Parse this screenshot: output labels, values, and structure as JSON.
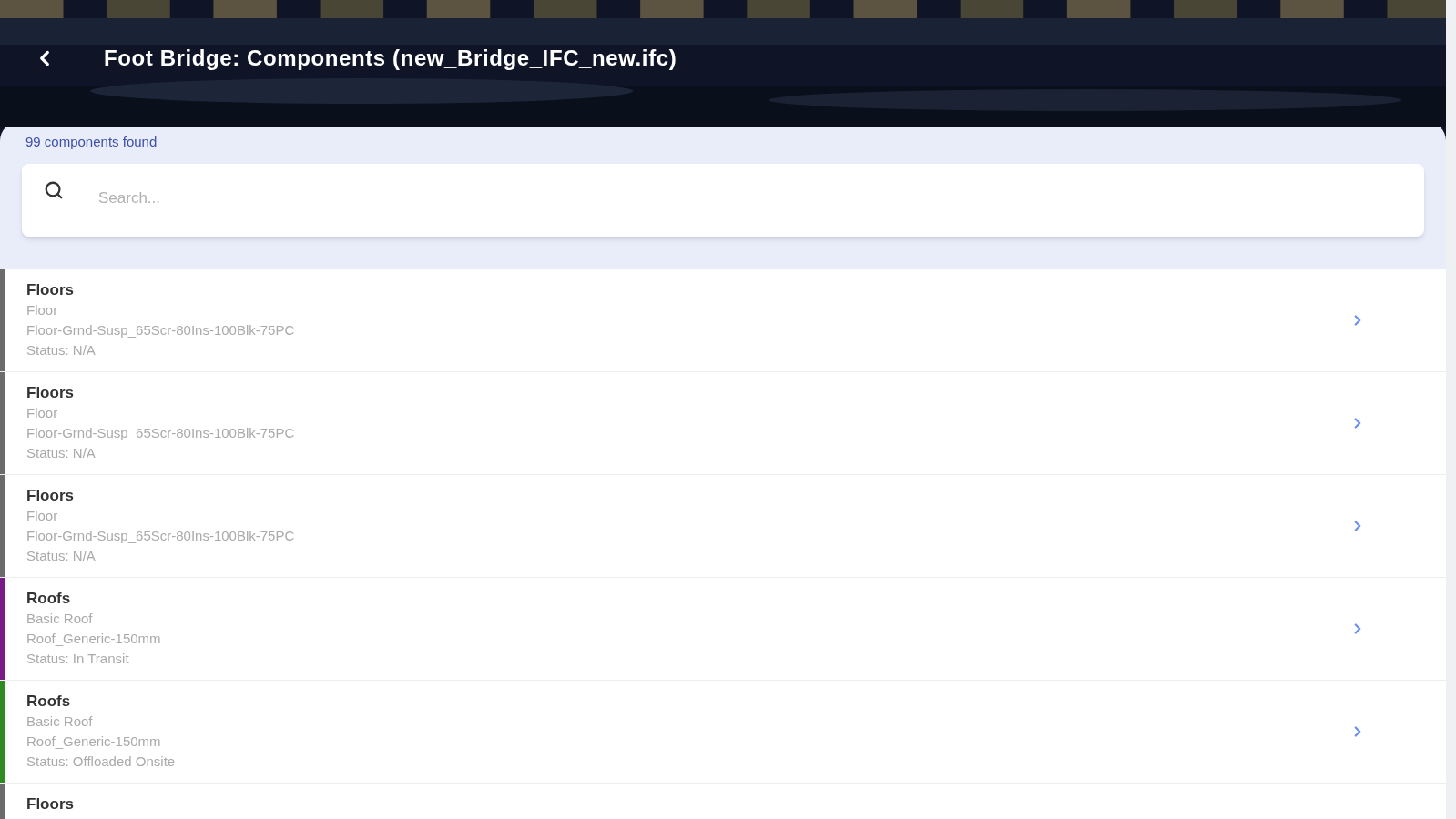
{
  "header": {
    "title": "Foot Bridge: Components (new_Bridge_IFC_new.ifc)"
  },
  "summary": "99 components found",
  "search": {
    "placeholder": "Search..."
  },
  "components": [
    {
      "category": "Floors",
      "type": "Floor",
      "name": "Floor-Grnd-Susp_65Scr-80Ins-100Blk-75PC",
      "status": "Status: N/A",
      "color": "#6b6b6b"
    },
    {
      "category": "Floors",
      "type": "Floor",
      "name": "Floor-Grnd-Susp_65Scr-80Ins-100Blk-75PC",
      "status": "Status: N/A",
      "color": "#6b6b6b"
    },
    {
      "category": "Floors",
      "type": "Floor",
      "name": "Floor-Grnd-Susp_65Scr-80Ins-100Blk-75PC",
      "status": "Status: N/A",
      "color": "#6b6b6b"
    },
    {
      "category": "Roofs",
      "type": "Basic Roof",
      "name": "Roof_Generic-150mm",
      "status": "Status: In Transit",
      "color": "#7a1a86"
    },
    {
      "category": "Roofs",
      "type": "Basic Roof",
      "name": "Roof_Generic-150mm",
      "status": "Status: Offloaded Onsite",
      "color": "#2f8a22"
    },
    {
      "category": "Floors",
      "color": "#6b6b6b"
    }
  ]
}
